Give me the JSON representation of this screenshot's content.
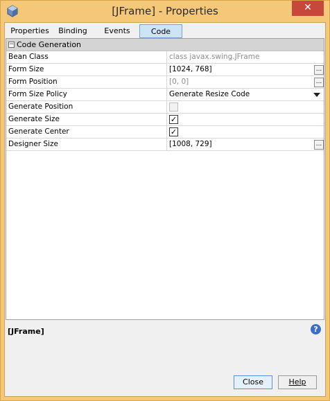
{
  "window": {
    "title": "[JFrame] - Properties",
    "close_glyph": "✕",
    "app_icon": "cube-icon"
  },
  "tabs": [
    {
      "label": "Properties",
      "active": false
    },
    {
      "label": "Binding",
      "active": false
    },
    {
      "label": "Events",
      "active": false
    },
    {
      "label": "Code",
      "active": true
    }
  ],
  "section": {
    "label": "Code Generation",
    "toggle": "−"
  },
  "properties": [
    {
      "name": "Bean Class",
      "value": "class javax.swing.JFrame",
      "type": "text-readonly"
    },
    {
      "name": "Form Size",
      "value": "[1024, 768]",
      "type": "text-ellipsis"
    },
    {
      "name": "Form Position",
      "value": "[0, 0]",
      "type": "text-ellipsis-readonly"
    },
    {
      "name": "Form Size Policy",
      "value": "Generate Resize Code",
      "type": "dropdown"
    },
    {
      "name": "Generate Position",
      "value": "",
      "type": "checkbox-disabled"
    },
    {
      "name": "Generate Size",
      "value": "✓",
      "type": "checkbox-checked"
    },
    {
      "name": "Generate Center",
      "value": "✓",
      "type": "checkbox-checked"
    },
    {
      "name": "Designer Size",
      "value": "[1008, 729]",
      "type": "text-ellipsis"
    }
  ],
  "ellipsis_label": "...",
  "description": {
    "title": "[JFrame]",
    "help_glyph": "?"
  },
  "buttons": {
    "close": "Close",
    "help": "Help"
  }
}
